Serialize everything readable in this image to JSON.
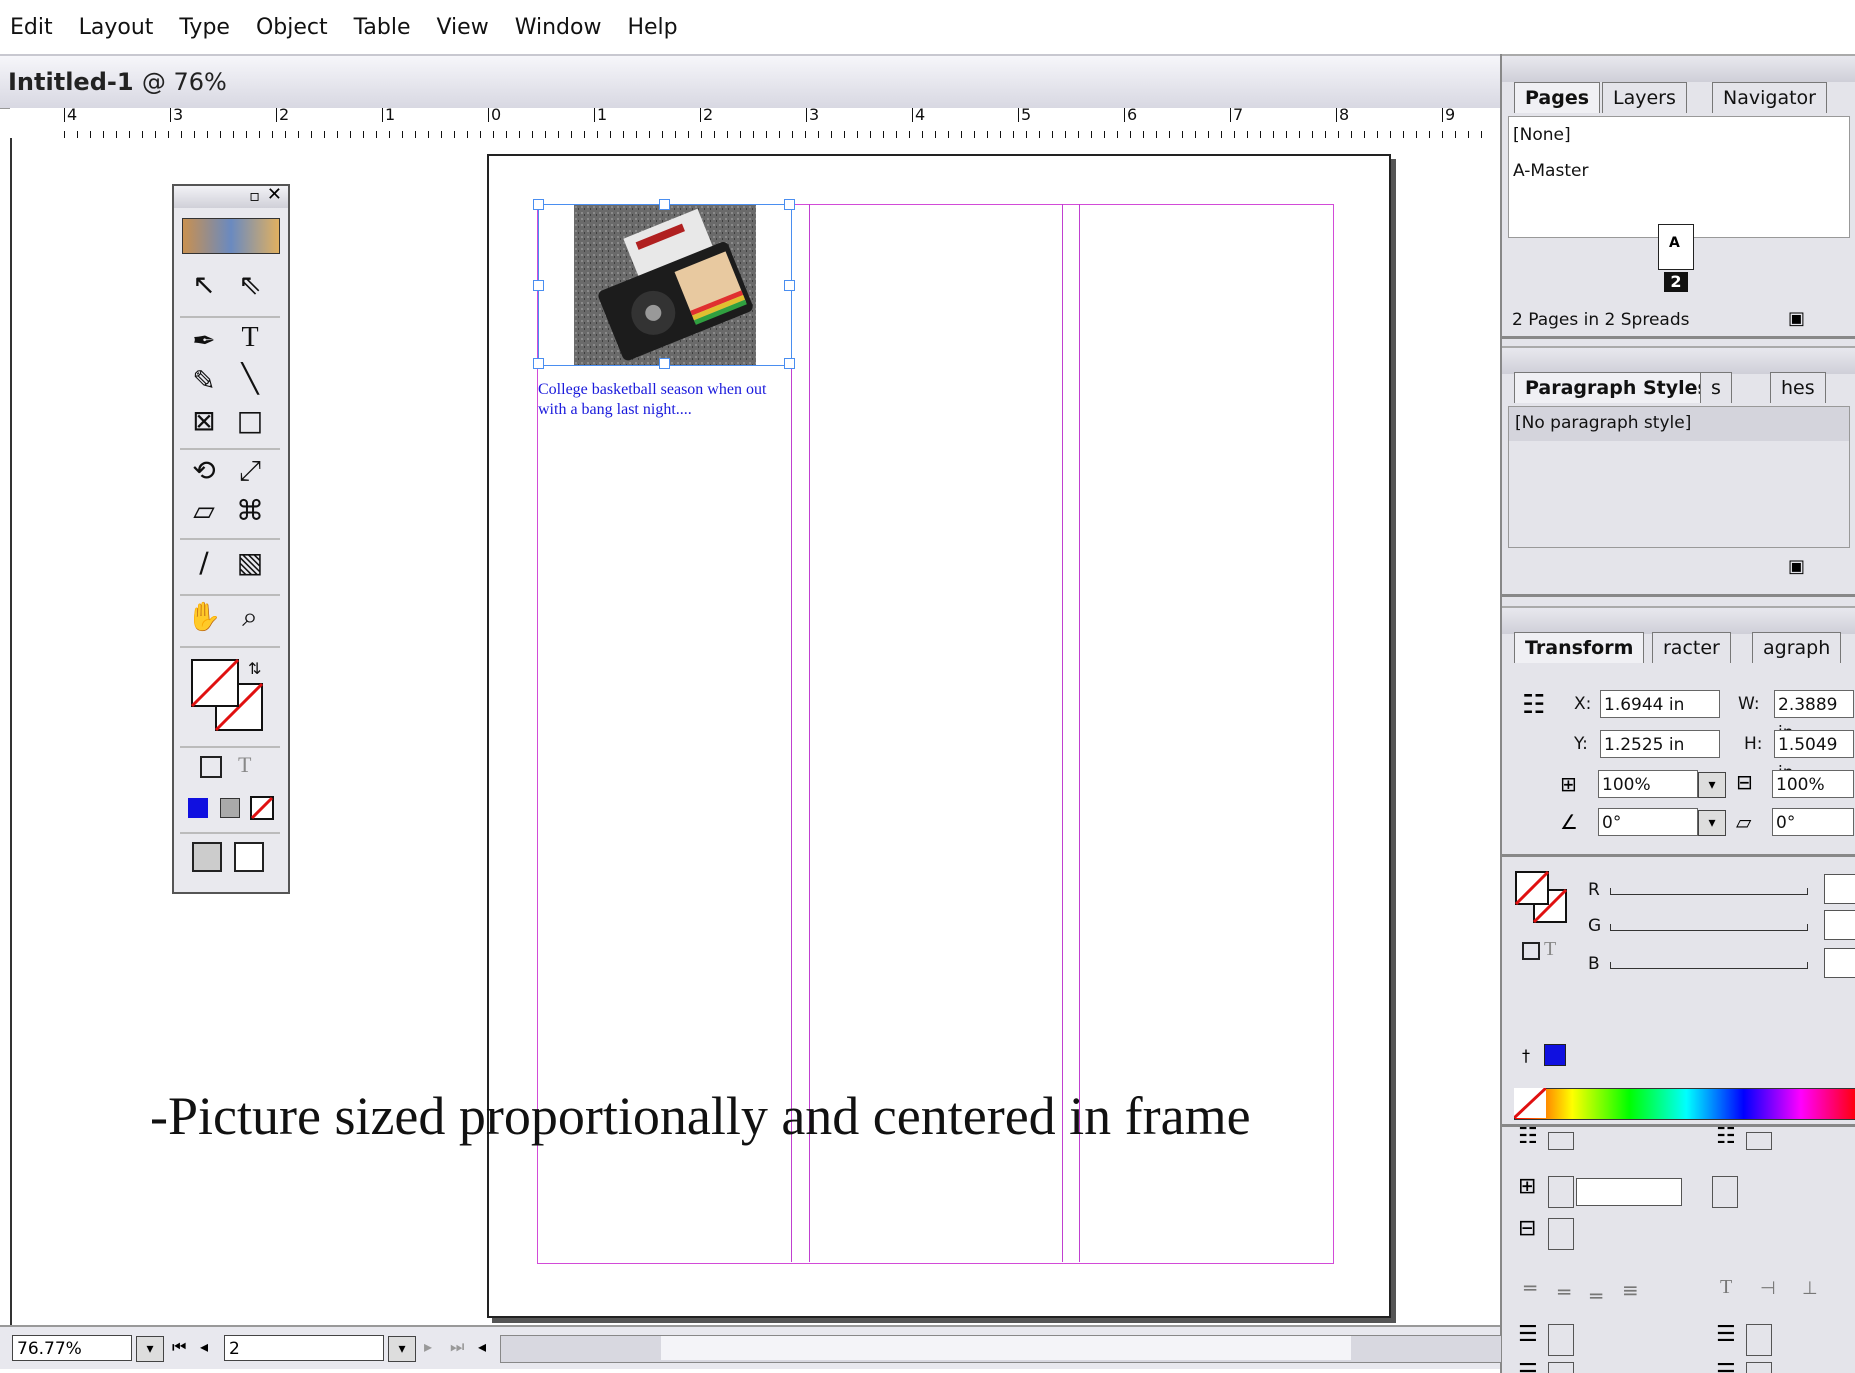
{
  "menu": [
    "Edit",
    "Layout",
    "Type",
    "Object",
    "Table",
    "View",
    "Window",
    "Help"
  ],
  "document": {
    "title": "Intitled-1",
    "zoom_title": "@ 76%"
  },
  "ruler": [
    "4",
    "3",
    "2",
    "1",
    "0",
    "1",
    "2",
    "3",
    "4",
    "5",
    "6",
    "7",
    "8",
    "9"
  ],
  "caption_text": "College basketball season when out with a bang last night....",
  "slide_caption": "-Picture sized proportionally and centered in frame",
  "pages_panel": {
    "tabs": [
      "Pages",
      "Layers",
      "Navigator"
    ],
    "none": "[None]",
    "master": "A-Master",
    "page_letter": "A",
    "page_number": "2",
    "summary": "2 Pages in 2 Spreads"
  },
  "paragraph_panel": {
    "tabs": [
      "Paragraph Styles",
      "s",
      "hes"
    ],
    "item": "[No paragraph style]"
  },
  "transform_panel": {
    "tabs": [
      "Transform",
      "racter",
      "agraph"
    ],
    "x_label": "X:",
    "x_value": "1.6944 in",
    "y_label": "Y:",
    "y_value": "1.2525 in",
    "w_label": "W:",
    "w_value": "2.3889 in",
    "h_label": "H:",
    "h_value": "1.5049 in",
    "scale_x": "100%",
    "scale_y": "100%",
    "rotate": "0°",
    "shear": "0°"
  },
  "color_panel": {
    "r": "R",
    "g": "G",
    "b": "B"
  },
  "status": {
    "zoom": "76.77%",
    "page": "2"
  },
  "colors": {
    "guide": "#d24bd8",
    "frame": "#4a8ef0",
    "caption": "#1a1adc"
  }
}
